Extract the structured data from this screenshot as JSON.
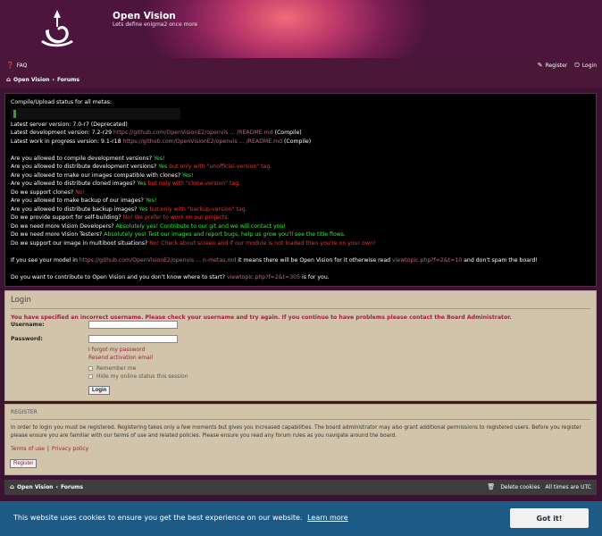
{
  "header": {
    "site_title": "Open Vision",
    "site_desc": "Lets define enigma2 once more"
  },
  "nav": {
    "faq": "FAQ",
    "register": "Register",
    "login": "Login",
    "crumb_home": "Open Vision",
    "crumb_sep": "‹",
    "crumb_forums": "Forums"
  },
  "status": {
    "compile_label": "Compile/Upload status for all metas:",
    "server_version": "Latest server version: 7.0-r7 (Deprecated)",
    "dev_prefix": "Latest development version: 7.2-r29 ",
    "dev_link": "https://github.com/OpenVisionE2/openvis ... /README.md",
    "dev_suffix": " (Compile)",
    "wip_prefix": "Latest work in progress version: 9.1-r18 ",
    "wip_link": "https://github.com/OpenVisionE2/openvis ... /README.md",
    "wip_suffix": " (Compile)",
    "q1": "Are you allowed to compile development versions? ",
    "a1": "Yes!",
    "q2": "Are you allowed to distribute development versions? ",
    "a2g": "Yes",
    "a2r": " but only with \"unofficial-version\" tag.",
    "q3": "Are you allowed to make our images compatible with clones? ",
    "a3": "Yes!",
    "q4": "Are you allowed to distribute cloned images? ",
    "a4g": "Yes",
    "a4r": " but only with \"clone-version\" tag.",
    "q5": "Do we support clones? ",
    "a5": "No!",
    "q6": "Are you allowed to make backup of our images? ",
    "a6": "Yes!",
    "q7": "Are you allowed to distribute backup images? ",
    "a7g": "Yes",
    "a7r": " but only with \"backup-version\" tag.",
    "q8": "Do we provide support for self-building? ",
    "a8": "No! We prefer to work on our projects.",
    "q9": "Do we need more Vision Developers? ",
    "a9": "Absolutely yes! Contribute to our git and we will contact you!",
    "q10": "Do we need more Vision Testers? ",
    "a10": "Absolutely yes! Test our images and report bugs, help us grow you'll see the title flows.",
    "q11": "Do we support our image in multiboot situations? ",
    "a11": "No! Check about screen and if our module is not loaded then you're on your own!",
    "model_prefix": "If you see your model in ",
    "model_link": "https://github.com/OpenVisionE2/openvis ... n-metas.md",
    "model_mid": " it means there will be Open Vision for it otherwise read ",
    "model_link2": "viewtopic.php?f=2&t=10",
    "model_suffix": " and don't spam the board!",
    "contrib_prefix": "Do you want to contribute to Open Vision and you don't know where to start? ",
    "contrib_link": "viewtopic.php?f=2&t=305",
    "contrib_suffix": " is for you."
  },
  "login": {
    "title": "Login",
    "error": "You have specified an incorrect username. Please check your username and try again. If you continue to have problems please contact the Board Administrator.",
    "username_label": "Username:",
    "password_label": "Password:",
    "username_value": "",
    "password_value": "",
    "forgot": "I forgot my password",
    "resend": "Resend activation email",
    "remember": "Remember me",
    "hide_online": "Hide my online status this session",
    "login_btn": "Login"
  },
  "register": {
    "title": "REGISTER",
    "text": "In order to login you must be registered. Registering takes only a few moments but gives you increased capabilities. The board administrator may also grant additional permissions to registered users. Before you register please ensure you are familiar with our terms of use and related policies. Please ensure you read any forum rules as you navigate around the board.",
    "terms": "Terms of use",
    "sep": "|",
    "privacy": "Privacy policy",
    "register_btn": "Register"
  },
  "footer": {
    "home": "Open Vision",
    "sep": "‹",
    "forums": "Forums",
    "delete_cookies": "Delete cookies",
    "timezone": "All times are UTC"
  },
  "cookie": {
    "message": "This website uses cookies to ensure you get the best experience on our website.",
    "learn_more": "Learn more",
    "got_it": "Got it!"
  },
  "colors": {
    "accent": "#9a2040",
    "panel": "#d2c4aa",
    "cookie_bar": "#1e5a86",
    "answer_green": "#33ee33",
    "answer_red": "#ee3333"
  }
}
